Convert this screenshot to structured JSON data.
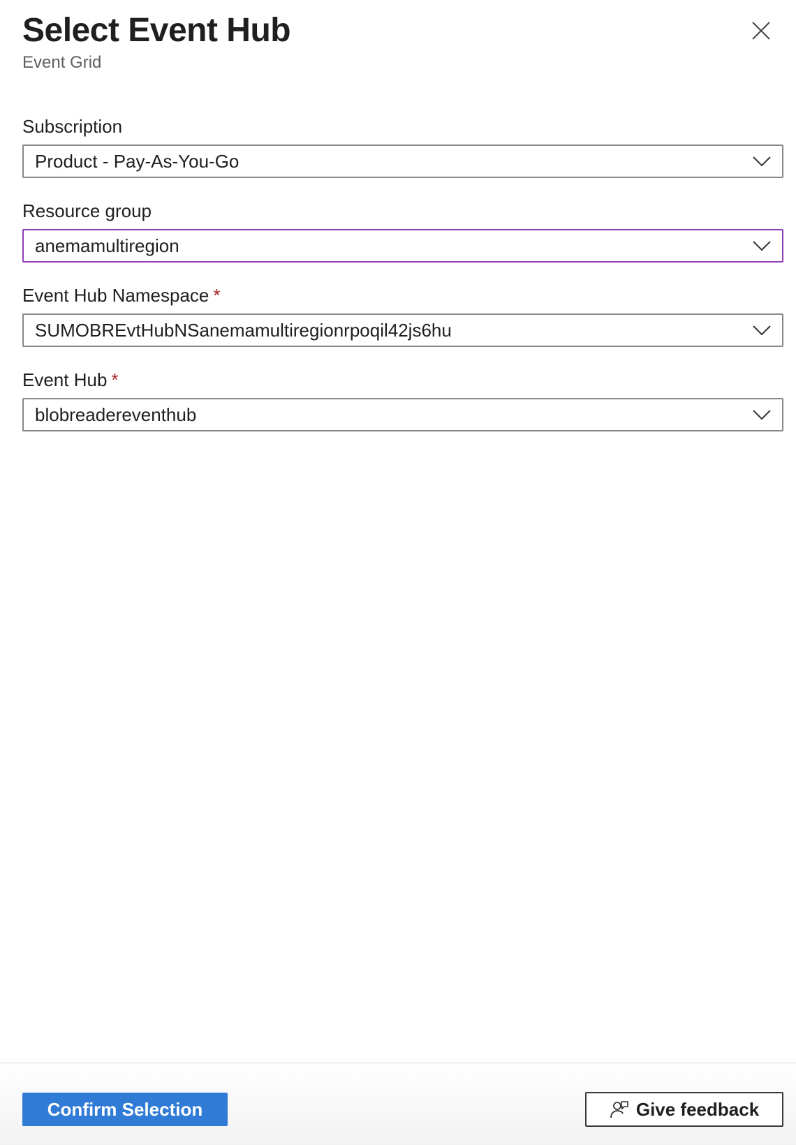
{
  "header": {
    "title": "Select Event Hub",
    "subtitle": "Event Grid",
    "close_icon": "close-icon"
  },
  "fields": {
    "subscription": {
      "label": "Subscription",
      "value": "Product - Pay-As-You-Go",
      "required": false
    },
    "resource_group": {
      "label": "Resource group",
      "value": "anemamultiregion",
      "required": false,
      "focused": true
    },
    "namespace": {
      "label": "Event Hub Namespace",
      "value": "SUMOBREvtHubNSanemamultiregionrpoqil42js6hu",
      "required": true
    },
    "event_hub": {
      "label": "Event Hub",
      "value": "blobreadereventhub",
      "required": true
    }
  },
  "required_marker": "*",
  "footer": {
    "confirm_label": "Confirm Selection",
    "feedback_label": "Give feedback",
    "feedback_icon": "feedback-person-icon"
  },
  "colors": {
    "primary": "#2f7bd6",
    "focus_border": "#8e3fb4",
    "required": "#a4262c",
    "border": "#8a8886"
  }
}
